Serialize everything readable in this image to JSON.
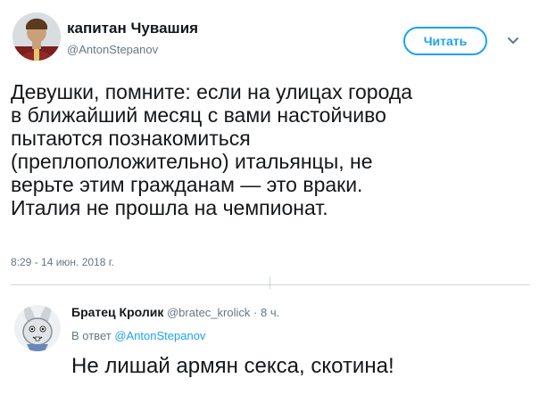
{
  "tweet": {
    "author_name": "капитан Чувашия",
    "author_handle": "@AntonStepanov",
    "follow_label": "Читать",
    "text_lines": [
      "Девушки, помните: если на улицах города",
      "в ближайший месяц с вами настойчиво",
      "пытаются познакомиться",
      "(преплоположительно) итальянцы, не",
      "верьте этим гражданам — это враки.",
      "Италия не прошла на чемпионат."
    ],
    "timestamp": "8:29 - 14 июн. 2018 г."
  },
  "reply": {
    "author_name": "Братец Кролик",
    "author_handle": "@bratec_krolick",
    "separator": "·",
    "time_ago": "8 ч.",
    "in_reply_prefix": "В ответ",
    "in_reply_to": "@AntonStepanov",
    "text": "Не лишай армян секса, скотина!"
  },
  "colors": {
    "accent": "#1da1f2",
    "text": "#14171a",
    "secondary": "#657786",
    "divider": "#cfd6dc"
  },
  "icons": {
    "main_avatar": "portrait-avatar",
    "reply_avatar": "rabbit-avatar",
    "menu": "chevron-down-icon"
  }
}
